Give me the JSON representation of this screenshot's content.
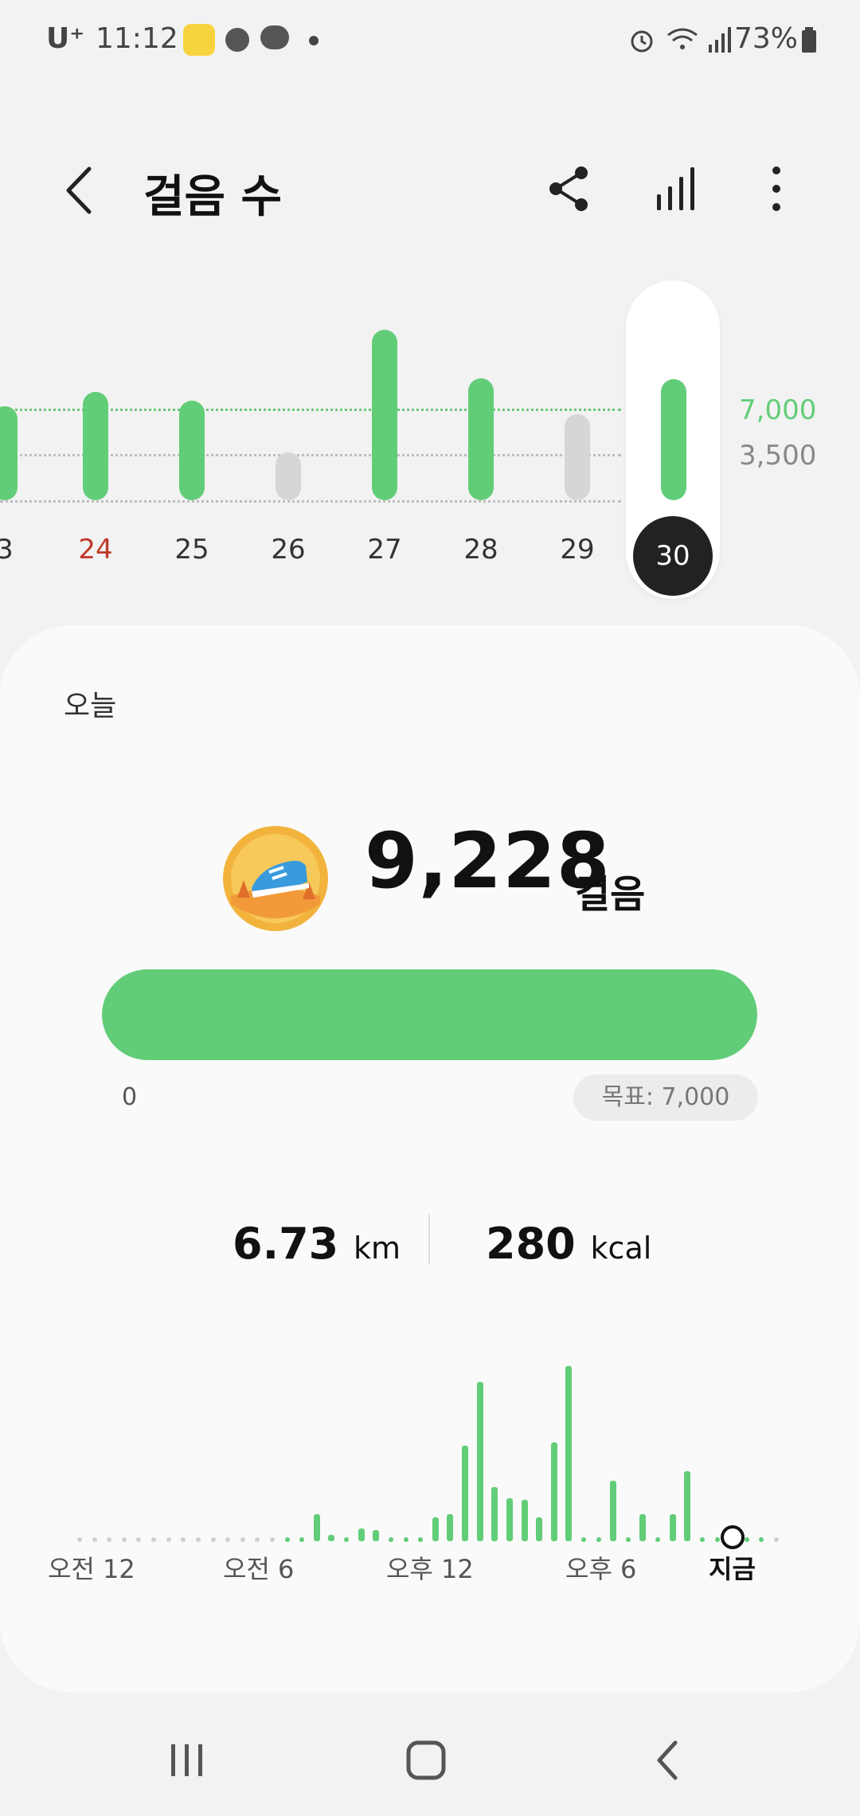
{
  "status_bar": {
    "carrier": "U⁺",
    "time": "11:12",
    "battery": "73%"
  },
  "header": {
    "title": "걸음 수"
  },
  "week_chart": {
    "days": [
      {
        "label": "3",
        "steps": 7200,
        "goal_met": true,
        "color": "#333"
      },
      {
        "label": "24",
        "steps": 8300,
        "goal_met": true,
        "color": "#c0392b"
      },
      {
        "label": "25",
        "steps": 7600,
        "goal_met": true,
        "color": "#333"
      },
      {
        "label": "26",
        "steps": 3100,
        "goal_met": false,
        "color": "#333"
      },
      {
        "label": "27",
        "steps": 13000,
        "goal_met": true,
        "color": "#333"
      },
      {
        "label": "28",
        "steps": 9300,
        "goal_met": true,
        "color": "#333"
      },
      {
        "label": "29",
        "steps": 6600,
        "goal_met": false,
        "color": "#333"
      },
      {
        "label": "30",
        "steps": 9228,
        "goal_met": true,
        "color": "#fff"
      }
    ],
    "goal_label": "7,000",
    "half_goal_label": "3,500",
    "goal_color": "#62cd78",
    "half_color": "#888888"
  },
  "today": {
    "label": "오늘",
    "steps": "9,228",
    "steps_unit": "걸음",
    "progress_fraction": 1.0,
    "progress_start": "0",
    "goal_text": "목표: 7,000",
    "distance_value": "6.73",
    "distance_unit": "km",
    "calories_value": "280",
    "calories_unit": "kcal"
  },
  "day_chart": {
    "hourly_relative": [
      0,
      0,
      0,
      0,
      0,
      0,
      0,
      0,
      0,
      0,
      0,
      0,
      0,
      0,
      0.02,
      0.02,
      0.17,
      0.04,
      0.02,
      0.08,
      0.07,
      0.03,
      0.03,
      0.03,
      0.15,
      0.17,
      0.6,
      1.0,
      0.34,
      0.27,
      0.26,
      0.15,
      0.62,
      1.1,
      0.02,
      0.02,
      0.38,
      0.02,
      0.17,
      0.02,
      0.17,
      0.44,
      0.02,
      0.02,
      0.02,
      0.02,
      0.02,
      0
    ],
    "time_labels": [
      "오전 12",
      "오전 6",
      "오후 12",
      "오후 6",
      "지금"
    ]
  },
  "colors": {
    "accent": "#62cd78",
    "inactive_bar": "#d6d6d6"
  }
}
